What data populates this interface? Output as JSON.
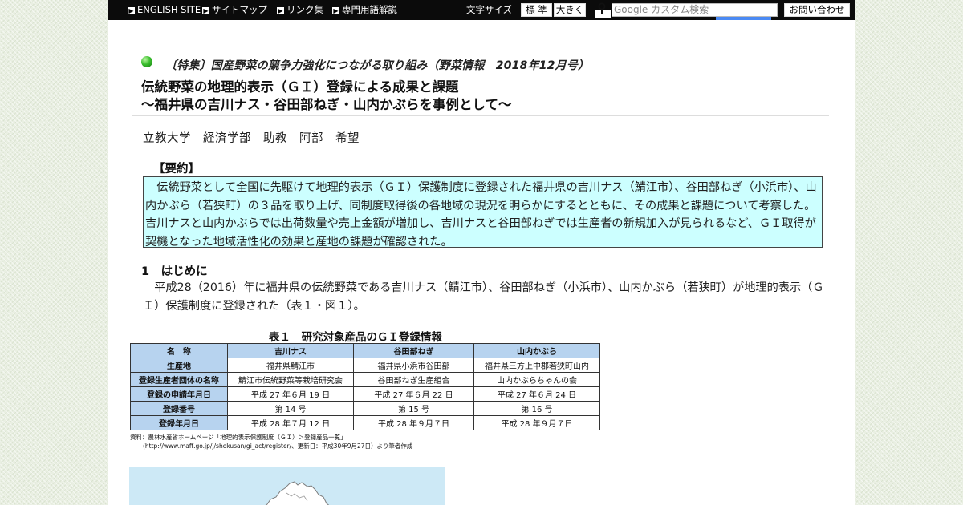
{
  "topbar": {
    "links": [
      {
        "label": "ENGLISH SITE",
        "icon": "arrow-right-icon"
      },
      {
        "label": "サイトマップ",
        "icon": "arrow-right-icon"
      },
      {
        "label": "リンク集",
        "icon": "arrow-right-icon"
      },
      {
        "label": "専門用語解説",
        "icon": "arrow-right-icon"
      }
    ],
    "font_size_label": "文字サイズ",
    "font_size_standard": "標 準",
    "font_size_large": "大きく",
    "search_placeholder": "Google カスタム検索",
    "contact_label": "お問い合わせ"
  },
  "article": {
    "feature_label": "〔特集〕国産野菜の競争力強化につながる取り組み（野菜情報　2018年12月号）",
    "title_line1": "伝統野菜の地理的表示（ＧＩ）登録による成果と課題",
    "title_line2": "〜福井県の吉川ナス・谷田部ねぎ・山内かぶらを事例として〜",
    "author": "立教大学　経済学部　助教　阿部　希望",
    "summary_heading": "【要約】",
    "summary_text": "伝統野菜として全国に先駆けて地理的表示（ＧＩ）保護制度に登録された福井県の吉川ナス（鯖江市）、谷田部ねぎ（小浜市）、山内かぶら（若狭町）の３品を取り上げ、同制度取得後の各地域の現況を明らかにするとともに、その成果と課題について考察した。吉川ナスと山内かぶらでは出荷数量や売上金額が増加し、吉川ナスと谷田部ねぎでは生産者の新規加入が見られるなど、ＧＩ取得が契機となった地域活性化の効果と産地の課題が確認された。",
    "section1_heading": "1　はじめに",
    "section1_text": "平成28（2016）年に福井県の伝統野菜である吉川ナス（鯖江市）、谷田部ねぎ（小浜市）、山内かぶら（若狭町）が地理的表示（ＧＩ）保護制度に登録された（表１・図１）。"
  },
  "table1": {
    "title": "表１　研究対象産品のＧＩ登録情報",
    "header": [
      "名　称",
      "吉川ナス",
      "谷田部ねぎ",
      "山内かぶら"
    ],
    "rows": [
      [
        "生産地",
        "福井県鯖江市",
        "福井県小浜市谷田部",
        "福井県三方上中郡若狭町山内"
      ],
      [
        "登録生産者団体の名称",
        "鯖江市伝統野菜等栽培研究会",
        "谷田部ねぎ生産組合",
        "山内かぶらちゃんの会"
      ],
      [
        "登録の申請年月日",
        "平成 27 年６月 19 日",
        "平成 27 年６月 22 日",
        "平成 27 年６月 24 日"
      ],
      [
        "登録番号",
        "第 14 号",
        "第 15 号",
        "第 16 号"
      ],
      [
        "登録年月日",
        "平成 28 年７月 12 日",
        "平成 28 年９月７日",
        "平成 28 年９月７日"
      ]
    ],
    "source_line1": "資料：農林水産省ホームページ「地理的表示保護制度（ＧＩ）＞登録産品一覧」",
    "source_line2": "(http://www.maff.go.jp/j/shokusan/gi_act/register/、更新日：平成30年9月27日）より筆者作成"
  },
  "colors": {
    "topbar_bg": "#0b0b0b",
    "summary_bg": "#ccffff",
    "table_header_bg": "#b7d3ef",
    "map_bg": "#cde9f6",
    "search_button": "#4a8af4",
    "bullet": "#3bbf2e"
  }
}
